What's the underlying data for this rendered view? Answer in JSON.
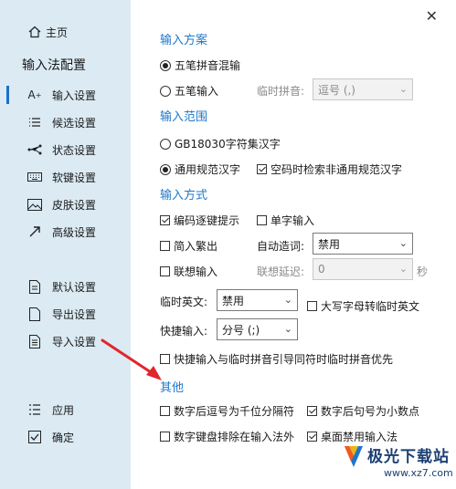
{
  "sidebar": {
    "home": "主页",
    "config_title": "输入法配置",
    "items": [
      {
        "label": "输入设置",
        "icon": "font-size-icon",
        "active": true
      },
      {
        "label": "候选设置",
        "icon": "candidate-list-icon",
        "active": false
      },
      {
        "label": "状态设置",
        "icon": "status-nodes-icon",
        "active": false
      },
      {
        "label": "软键设置",
        "icon": "keyboard-icon",
        "active": false
      },
      {
        "label": "皮肤设置",
        "icon": "skin-image-icon",
        "active": false
      },
      {
        "label": "高级设置",
        "icon": "advanced-arrow-icon",
        "active": false
      }
    ],
    "actions": [
      {
        "label": "默认设置",
        "icon": "default-doc-icon"
      },
      {
        "label": "导出设置",
        "icon": "export-doc-icon"
      },
      {
        "label": "导入设置",
        "icon": "import-doc-icon"
      }
    ],
    "apply": "应用",
    "ok": "确定"
  },
  "scheme": {
    "title": "输入方案",
    "opt1": "五笔拼音混输",
    "opt2": "五笔输入",
    "temp_pinyin_label": "临时拼音:",
    "temp_pinyin_value": "逗号 (,)"
  },
  "range": {
    "title": "输入范围",
    "opt1": "GB18030字符集汉字",
    "opt2": "通用规范汉字",
    "cb_empty_code": "空码时检索非通用规范汉字"
  },
  "method": {
    "title": "输入方式",
    "cb_code_hint": "编码逐键提示",
    "cb_single_char": "单字输入",
    "cb_simp_to_trad": "简入繁出",
    "auto_word_label": "自动造词:",
    "auto_word_value": "禁用",
    "cb_assoc": "联想输入",
    "assoc_delay_label": "联想延迟:",
    "assoc_delay_value": "0",
    "assoc_delay_unit": "秒",
    "temp_english_label": "临时英文:",
    "temp_english_value": "禁用",
    "cb_caps_temp_english": "大写字母转临时英文",
    "shortcut_label": "快捷输入:",
    "shortcut_value": "分号 (;)",
    "cb_shortcut_priority": "快捷输入与临时拼音引导同符时临时拼音优先"
  },
  "other": {
    "title": "其他",
    "cb_thousand_sep": "数字后逗号为千位分隔符",
    "cb_decimal_point": "数字后句号为小数点",
    "cb_numpad_exclude": "数字键盘排除在输入法外",
    "cb_desktop_disable": "桌面禁用输入法"
  },
  "watermark": {
    "brand": "极光下载站",
    "url": "www.xz7.com"
  },
  "colors": {
    "accent": "#1d77c9",
    "sidebar_bg": "#dbeaf3",
    "arrow": "#e0262b"
  }
}
